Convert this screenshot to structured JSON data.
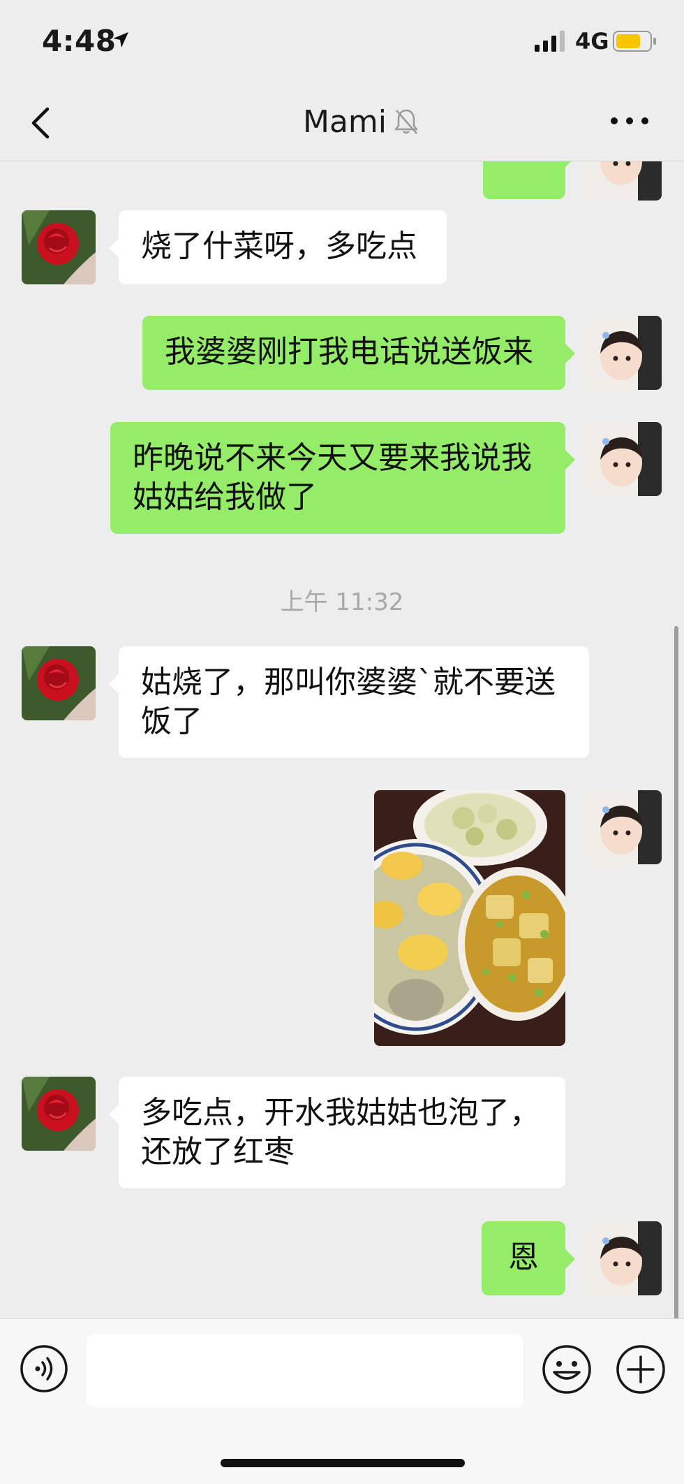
{
  "status_bar": {
    "time": "4:48",
    "network": "4G"
  },
  "nav": {
    "title": "Mami"
  },
  "messages": [
    {
      "side": "left",
      "text": "烧了什菜呀，多吃点"
    },
    {
      "side": "right",
      "text": "我婆婆刚打我电话说送饭来"
    },
    {
      "side": "right",
      "text": "昨晚说不来今天又要来我说我姑姑给我做了"
    },
    {
      "side": "left",
      "text": "姑烧了，那叫你婆婆`就不要送饭了"
    },
    {
      "side": "left",
      "text": "多吃点，开水我姑姑也泡了，还放了红枣"
    },
    {
      "side": "right",
      "text": "恩"
    }
  ],
  "timestamp": "上午 11:32",
  "input": {
    "value": ""
  },
  "colors": {
    "background": "#ededed",
    "sent_bubble": "#95ec69",
    "received_bubble": "#ffffff"
  }
}
